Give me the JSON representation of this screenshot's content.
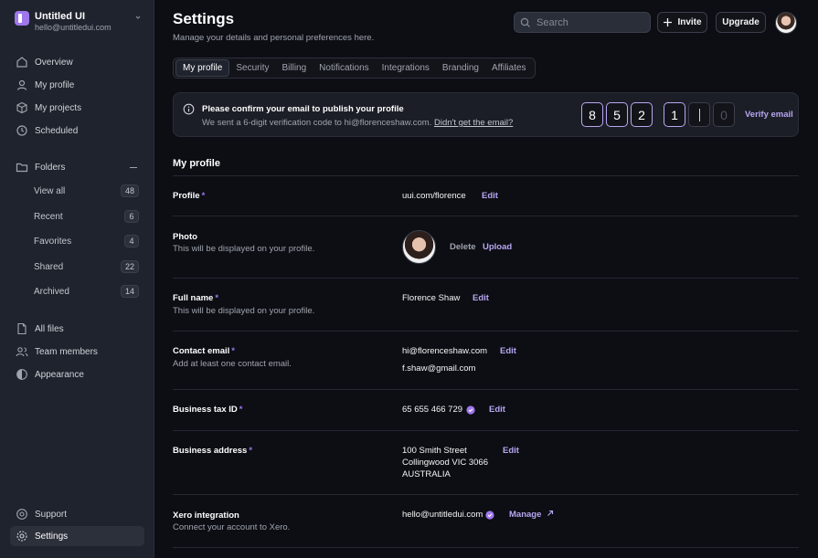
{
  "sidebar": {
    "brand_name": "Untitled UI",
    "brand_email": "hello@untitledui.com",
    "nav": [
      {
        "label": "Overview",
        "icon": "grid-icon"
      },
      {
        "label": "My profile",
        "icon": "user-icon"
      },
      {
        "label": "My projects",
        "icon": "cube-icon"
      },
      {
        "label": "Scheduled",
        "icon": "clock-icon"
      }
    ],
    "folders_label": "Folders",
    "folders": [
      {
        "label": "View all",
        "count": "48"
      },
      {
        "label": "Recent",
        "count": "6"
      },
      {
        "label": "Favorites",
        "count": "4"
      },
      {
        "label": "Shared",
        "count": "22"
      },
      {
        "label": "Archived",
        "count": "14"
      }
    ],
    "nav2": [
      {
        "label": "All files",
        "icon": "file-icon"
      },
      {
        "label": "Team members",
        "icon": "users-icon"
      },
      {
        "label": "Appearance",
        "icon": "contrast-icon"
      }
    ],
    "bottom": [
      {
        "label": "Support",
        "icon": "help-icon"
      },
      {
        "label": "Settings",
        "icon": "gear-icon"
      }
    ]
  },
  "header": {
    "title": "Settings",
    "subtitle": "Manage your details and personal preferences here.",
    "search_placeholder": "Search",
    "invite_label": "Invite",
    "upgrade_label": "Upgrade"
  },
  "tabs": [
    "My profile",
    "Security",
    "Billing",
    "Notifications",
    "Integrations",
    "Branding",
    "Affiliates"
  ],
  "banner": {
    "title": "Please confirm your email to publish your profile",
    "text": "We sent a 6-digit verification code to hi@florenceshaw.com.",
    "link": "Didn't get the email?",
    "otp": [
      "8",
      "5",
      "2",
      "1",
      "",
      "0"
    ],
    "verify_label": "Verify email"
  },
  "profile": {
    "section_title": "My profile",
    "profile_label": "Profile",
    "profile_value": "uui.com/florence",
    "photo_label": "Photo",
    "photo_help": "This will be displayed on your profile.",
    "delete_label": "Delete",
    "upload_label": "Upload",
    "fullname_label": "Full name",
    "fullname_help": "This will be displayed on your profile.",
    "fullname_value": "Florence Shaw",
    "email_label": "Contact email",
    "email_help": "Add at least one contact email.",
    "email_primary": "hi@florenceshaw.com",
    "email_secondary": "f.shaw@gmail.com",
    "tax_label": "Business tax ID",
    "tax_value": "65 655 466 729",
    "address_label": "Business address",
    "address_line1": "100 Smith Street",
    "address_line2": "Collingwood VIC 3066",
    "address_line3": "AUSTRALIA",
    "xero_label": "Xero integration",
    "xero_help": "Connect your account to Xero.",
    "xero_value": "hello@untitledui.com",
    "manage_label": "Manage",
    "edit_label": "Edit",
    "required_mark": "*"
  },
  "colors": {
    "accent": "#9e77ed",
    "link": "#b9a6f2",
    "background": "#0c0e14",
    "sidebar": "#1f232d"
  }
}
